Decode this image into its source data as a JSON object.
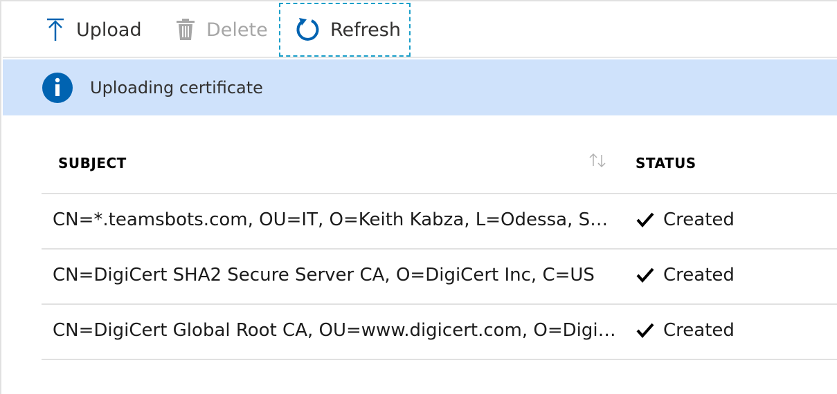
{
  "toolbar": {
    "upload_label": "Upload",
    "delete_label": "Delete",
    "refresh_label": "Refresh"
  },
  "notification": {
    "message": "Uploading certificate"
  },
  "table": {
    "columns": [
      "SUBJECT",
      "STATUS"
    ],
    "rows": [
      {
        "subject": "CN=*.teamsbots.com, OU=IT, O=Keith Kabza, L=Odessa, S=F…",
        "status": "Created"
      },
      {
        "subject": "CN=DigiCert SHA2 Secure Server CA, O=DigiCert Inc, C=US",
        "status": "Created"
      },
      {
        "subject": "CN=DigiCert Global Root CA, OU=www.digicert.com, O=Digi…",
        "status": "Created"
      }
    ]
  },
  "colors": {
    "accent": "#0063b1",
    "info_bar": "#cfe2fb",
    "focus_outline": "#1a9fc9",
    "disabled_text": "#a6a6a6"
  },
  "icons": {
    "upload": "upload-arrow-icon",
    "delete": "trash-icon",
    "refresh": "refresh-icon",
    "info": "info-icon",
    "sort": "sort-icon",
    "status": "checkmark-icon"
  }
}
